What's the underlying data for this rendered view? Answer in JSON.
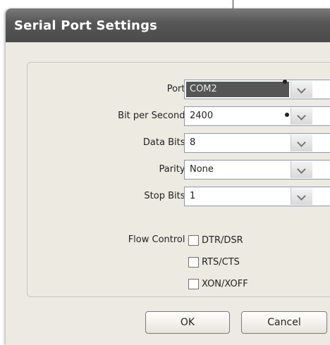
{
  "dialog": {
    "title": "Serial Port Settings"
  },
  "fields": {
    "port": {
      "label": "Port :",
      "value": "COM2"
    },
    "baud": {
      "label": "Bit per Second :",
      "value": "2400"
    },
    "data_bits": {
      "label": "Data Bits :",
      "value": "8"
    },
    "parity": {
      "label": "Parity :",
      "value": "None"
    },
    "stop_bits": {
      "label": "Stop Bits :",
      "value": "1"
    }
  },
  "flow_control": {
    "label": "Flow Control :",
    "options": [
      "DTR/DSR",
      "RTS/CTS",
      "XON/XOFF"
    ]
  },
  "buttons": {
    "ok": "OK",
    "cancel": "Cancel"
  },
  "colors": {
    "titlebar": "#585858",
    "dialog_bg": "#eceae3",
    "selection": "#555555"
  }
}
